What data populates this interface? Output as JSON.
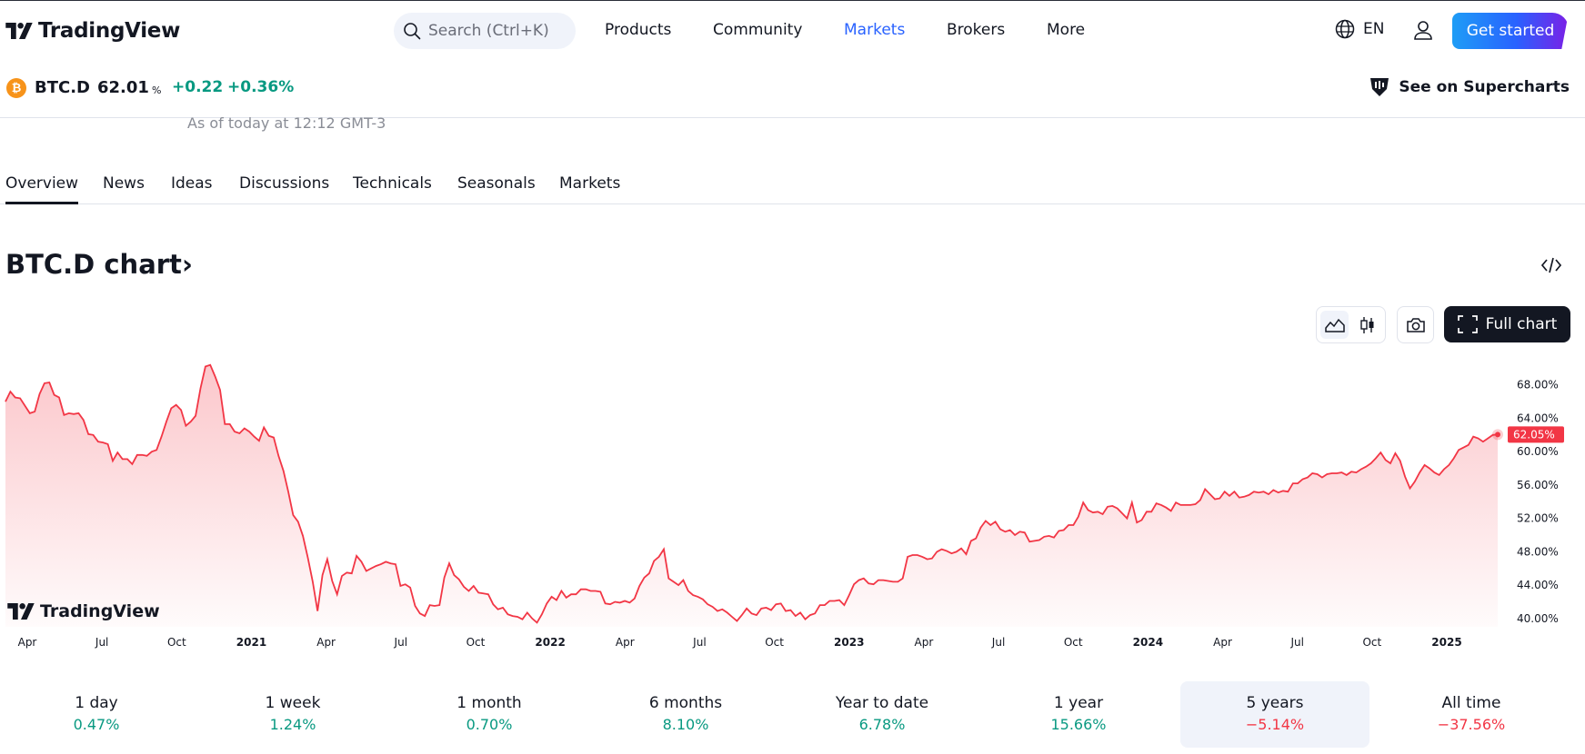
{
  "header": {
    "brand": "TradingView",
    "search_placeholder": "Search (Ctrl+K)",
    "nav": [
      "Products",
      "Community",
      "Markets",
      "Brokers",
      "More"
    ],
    "active_nav": "Markets",
    "lang": "EN",
    "cta": "Get started"
  },
  "symbol": {
    "ticker": "BTC.D",
    "price": "62.01",
    "unit": "%",
    "change": "+0.22",
    "change_pct": "+0.36%",
    "icon_letter": "₿",
    "supercharts": "See on Supercharts",
    "as_of": "As of today at 12:12 GMT-3"
  },
  "tabs": [
    "Overview",
    "News",
    "Ideas",
    "Discussions",
    "Technicals",
    "Seasonals",
    "Markets"
  ],
  "active_tab": "Overview",
  "chart_section": {
    "title": "BTC.D chart",
    "chevron": "›",
    "full_chart": "Full chart",
    "watermark": "TradingView"
  },
  "chart_data": {
    "type": "area",
    "series": [
      {
        "values": [
          66.0,
          67.2,
          66.5,
          66.4,
          65.5,
          64.6,
          64.8,
          66.9,
          68.2,
          68.3,
          66.8,
          66.5,
          64.4,
          64.6,
          64.5,
          64.6,
          63.8,
          62.1,
          62.0,
          61.2,
          61.1,
          60.9,
          58.9,
          59.9,
          59.1,
          59.1,
          58.5,
          59.6,
          59.6,
          59.5,
          60.0,
          60.2,
          61.8,
          63.6,
          65.2,
          65.6,
          65.0,
          63.1,
          63.6,
          64.3,
          67.6,
          70.2,
          70.4,
          69.0,
          67.4,
          63.3,
          63.3,
          62.4,
          62.2,
          62.8,
          62.4,
          61.8,
          61.3,
          62.9,
          61.9,
          61.7,
          59.5,
          57.7,
          55.2,
          52.4,
          51.6,
          49.9,
          47.3,
          44.4,
          40.9,
          45.2,
          47.1,
          44.5,
          42.9,
          45.1,
          45.5,
          45.4,
          47.5,
          46.8,
          45.7,
          46.0,
          46.3,
          46.5,
          46.8,
          46.6,
          46.5,
          43.9,
          44.1,
          43.7,
          41.5,
          40.6,
          40.3,
          41.6,
          41.5,
          41.6,
          44.9,
          46.6,
          45.2,
          44.7,
          43.8,
          43.3,
          43.9,
          43.1,
          43.0,
          42.9,
          41.7,
          41.1,
          41.3,
          40.5,
          40.3,
          40.2,
          39.9,
          40.7,
          40.0,
          39.5,
          40.5,
          41.8,
          42.6,
          42.2,
          43.3,
          42.5,
          42.9,
          42.9,
          43.5,
          43.5,
          43.3,
          43.3,
          43.2,
          41.8,
          41.7,
          42.0,
          41.9,
          42.1,
          41.9,
          42.4,
          43.9,
          44.9,
          45.4,
          46.9,
          47.4,
          48.3,
          44.8,
          44.4,
          44.0,
          44.6,
          43.3,
          42.8,
          42.6,
          42.3,
          41.7,
          41.4,
          40.9,
          41.1,
          40.7,
          40.2,
          39.7,
          40.4,
          41.2,
          40.6,
          40.4,
          41.2,
          41.3,
          41.0,
          41.7,
          41.8,
          40.9,
          41.0,
          40.3,
          40.7,
          39.9,
          40.4,
          40.6,
          41.6,
          41.6,
          42.1,
          42.1,
          42.2,
          41.6,
          42.8,
          44.1,
          44.6,
          44.8,
          44.2,
          44.1,
          44.6,
          44.6,
          44.5,
          44.4,
          44.4,
          44.8,
          47.4,
          47.6,
          47.6,
          47.4,
          47.1,
          47.2,
          48.0,
          48.3,
          48.1,
          47.8,
          48.0,
          48.4,
          47.7,
          49.3,
          49.6,
          50.9,
          51.7,
          51.2,
          51.6,
          50.7,
          50.4,
          50.6,
          50.0,
          50.4,
          50.3,
          49.2,
          49.3,
          49.4,
          49.8,
          49.9,
          49.7,
          50.5,
          50.6,
          51.2,
          51.2,
          52.2,
          53.9,
          53.0,
          52.7,
          52.8,
          52.5,
          53.4,
          53.5,
          53.2,
          52.6,
          52.0,
          53.9,
          51.5,
          51.8,
          52.8,
          52.8,
          53.8,
          53.6,
          53.3,
          52.9,
          53.9,
          53.6,
          53.6,
          53.6,
          53.7,
          54.2,
          55.5,
          54.9,
          54.3,
          54.4,
          55.2,
          54.7,
          55.2,
          54.5,
          54.6,
          54.8,
          55.2,
          55.1,
          55.2,
          54.9,
          55.4,
          55.1,
          55.3,
          55.2,
          56.2,
          56.2,
          56.7,
          56.9,
          57.4,
          57.3,
          56.9,
          57.3,
          57.4,
          57.4,
          57.5,
          57.2,
          57.6,
          57.5,
          57.9,
          58.2,
          58.6,
          59.2,
          59.9,
          59.0,
          58.6,
          59.8,
          58.9,
          57.0,
          55.6,
          56.4,
          57.5,
          58.4,
          58.0,
          57.5,
          57.2,
          57.9,
          58.4,
          59.2,
          60.2,
          60.5,
          60.8,
          61.8,
          61.6,
          61.2,
          61.6,
          62.0,
          62.05
        ],
        "x_start": "2020-03",
        "x_end": "2025-03"
      }
    ],
    "x_ticks": [
      "Apr",
      "Jul",
      "Oct",
      "2021",
      "Apr",
      "Jul",
      "Oct",
      "2022",
      "Apr",
      "Jul",
      "Oct",
      "2023",
      "Apr",
      "Jul",
      "Oct",
      "2024",
      "Apr",
      "Jul",
      "Oct",
      "2025"
    ],
    "bold_ticks": [
      "2021",
      "2022",
      "2023",
      "2024",
      "2025"
    ],
    "y_ticks": [
      "40.00%",
      "44.00%",
      "48.00%",
      "52.00%",
      "56.00%",
      "60.00%",
      "64.00%",
      "68.00%"
    ],
    "ylim": [
      39.0,
      70.8
    ],
    "last_value_label": "62.05%",
    "line_color": "#f23645"
  },
  "periods": [
    {
      "label": "1 day",
      "value": "0.47%",
      "dir": "up"
    },
    {
      "label": "1 week",
      "value": "1.24%",
      "dir": "up"
    },
    {
      "label": "1 month",
      "value": "0.70%",
      "dir": "up"
    },
    {
      "label": "6 months",
      "value": "8.10%",
      "dir": "up"
    },
    {
      "label": "Year to date",
      "value": "6.78%",
      "dir": "up"
    },
    {
      "label": "1 year",
      "value": "15.66%",
      "dir": "up"
    },
    {
      "label": "5 years",
      "value": "−5.14%",
      "dir": "down"
    },
    {
      "label": "All time",
      "value": "−37.56%",
      "dir": "down"
    }
  ],
  "active_period": "5 years"
}
